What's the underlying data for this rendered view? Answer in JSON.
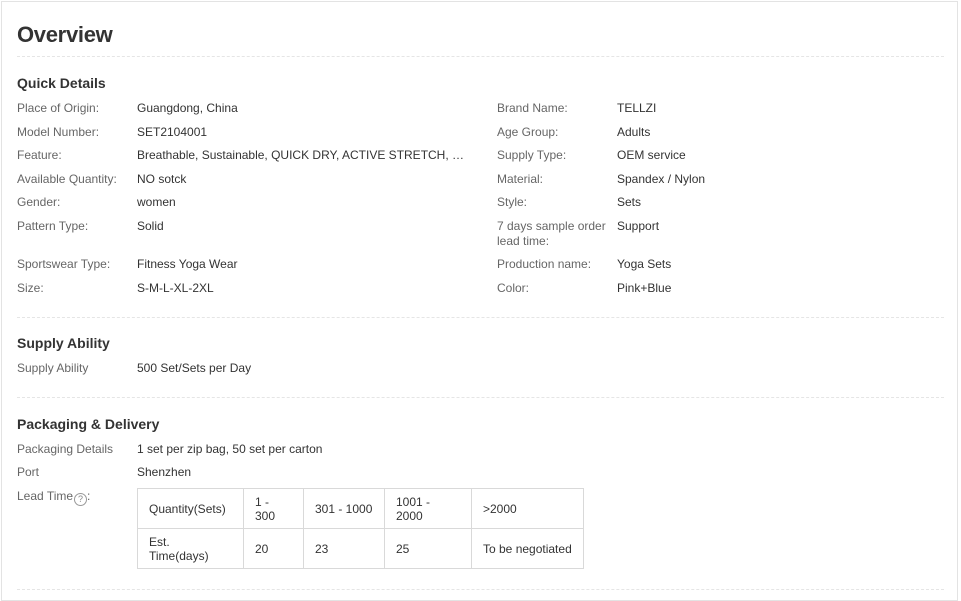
{
  "page_title": "Overview",
  "quick_details": {
    "title": "Quick Details",
    "left": [
      {
        "label": "Place of Origin:",
        "value": "Guangdong, China"
      },
      {
        "label": "Model Number:",
        "value": "SET2104001"
      },
      {
        "label": "Feature:",
        "value": "Breathable, Sustainable, QUICK DRY, ACTIVE STRETCH, Swe..."
      },
      {
        "label": "Available Quantity:",
        "value": "NO sotck"
      },
      {
        "label": "Gender:",
        "value": "women"
      },
      {
        "label": "Pattern Type:",
        "value": "Solid"
      },
      {
        "label": "Sportswear Type:",
        "value": "Fitness Yoga Wear"
      },
      {
        "label": "Size:",
        "value": "S-M-L-XL-2XL"
      }
    ],
    "right": [
      {
        "label": "Brand Name:",
        "value": "TELLZI"
      },
      {
        "label": "Age Group:",
        "value": "Adults"
      },
      {
        "label": "Supply Type:",
        "value": "OEM service"
      },
      {
        "label": "Material:",
        "value": "Spandex / Nylon"
      },
      {
        "label": "Style:",
        "value": "Sets"
      },
      {
        "label": "7 days sample order lead time:",
        "value": "Support"
      },
      {
        "label": "Production name:",
        "value": "Yoga Sets"
      },
      {
        "label": "Color:",
        "value": "Pink+Blue"
      }
    ]
  },
  "supply_ability": {
    "title": "Supply Ability",
    "label": "Supply Ability",
    "value": "500 Set/Sets per Day"
  },
  "packaging": {
    "title": "Packaging & Delivery",
    "details_label": "Packaging Details",
    "details_value": "1 set per zip bag, 50 set per carton",
    "port_label": "Port",
    "port_value": "Shenzhen",
    "lead_label": "Lead Time",
    "lead_suffix": ":",
    "help_glyph": "?",
    "help_icon": "question-circle-icon",
    "lead_table": {
      "row1": [
        "Quantity(Sets)",
        "1 - 300",
        "301 - 1000",
        "1001 - 2000",
        ">2000"
      ],
      "row2": [
        "Est. Time(days)",
        "20",
        "23",
        "25",
        "To be negotiated"
      ]
    }
  },
  "colors": {
    "label": "#666666",
    "value": "#333333",
    "border": "#d9d9d9"
  }
}
